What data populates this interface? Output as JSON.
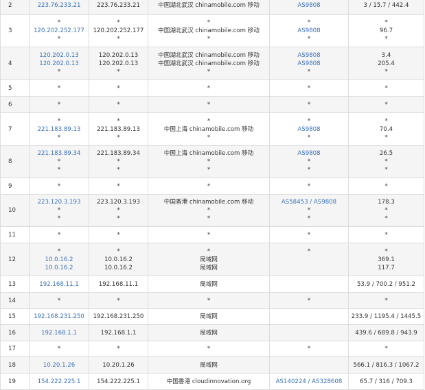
{
  "colors": {
    "link": "#3b72b8",
    "text": "#333333",
    "row_alt": "#f5f5f5",
    "border": "#dcdcdc"
  },
  "rows": [
    {
      "hop": "2",
      "ip": [
        "223.76.233.21"
      ],
      "host": [
        "223.76.233.21"
      ],
      "loc": [
        "中国湖北武汉 chinamobile.com 移动"
      ],
      "asn": [
        "AS9808"
      ],
      "time": [
        "3 / 15.7 / 442.4"
      ]
    },
    {
      "hop": "3",
      "ip": [
        "*",
        "120.202.252.177",
        "*"
      ],
      "host": [
        "*",
        "120.202.252.177",
        "*"
      ],
      "loc": [
        "*",
        "中国湖北武汉 chinamobile.com 移动",
        "*"
      ],
      "asn": [
        "*",
        "AS9808",
        "*"
      ],
      "time": [
        "*",
        "96.7",
        "*"
      ]
    },
    {
      "hop": "4",
      "ip": [
        "120.202.0.13",
        "120.202.0.13",
        "*"
      ],
      "host": [
        "120.202.0.13",
        "120.202.0.13",
        "*"
      ],
      "loc": [
        "中国湖北武汉 chinamobile.com 移动",
        "中国湖北武汉 chinamobile.com 移动",
        "*"
      ],
      "asn": [
        "AS9808",
        "AS9808",
        "*"
      ],
      "time": [
        "3.4",
        "205.4",
        "*"
      ]
    },
    {
      "hop": "5",
      "ip": [
        "*"
      ],
      "host": [
        "*"
      ],
      "loc": [
        "*"
      ],
      "asn": [
        "*"
      ],
      "time": [
        "*"
      ]
    },
    {
      "hop": "6",
      "ip": [
        "*"
      ],
      "host": [
        "*"
      ],
      "loc": [
        "*"
      ],
      "asn": [
        "*"
      ],
      "time": [
        "*"
      ]
    },
    {
      "hop": "7",
      "ip": [
        "*",
        "221.183.89.13",
        "*"
      ],
      "host": [
        "*",
        "221.183.89.13",
        "*"
      ],
      "loc": [
        "*",
        "中国上海 chinamobile.com 移动",
        "*"
      ],
      "asn": [
        "*",
        "AS9808",
        "*"
      ],
      "time": [
        "*",
        "70.4",
        "*"
      ]
    },
    {
      "hop": "8",
      "ip": [
        "221.183.89.34",
        "*",
        "*"
      ],
      "host": [
        "221.183.89.34",
        "*",
        "*"
      ],
      "loc": [
        "中国上海 chinamobile.com 移动",
        "*",
        "*"
      ],
      "asn": [
        "AS9808",
        "*",
        "*"
      ],
      "time": [
        "26.5",
        "*",
        "*"
      ]
    },
    {
      "hop": "9",
      "ip": [
        "*"
      ],
      "host": [
        "*"
      ],
      "loc": [
        "*"
      ],
      "asn": [
        "*"
      ],
      "time": [
        "*"
      ]
    },
    {
      "hop": "10",
      "ip": [
        "223.120.3.193",
        "*",
        "*"
      ],
      "host": [
        "223.120.3.193",
        "*",
        "*"
      ],
      "loc": [
        "中国香港 chinamobile.com 移动",
        "*",
        "*"
      ],
      "asn": [
        "AS58453 / AS9808",
        "*",
        "*"
      ],
      "time": [
        "178.3",
        "*",
        "*"
      ]
    },
    {
      "hop": "11",
      "ip": [
        "*"
      ],
      "host": [
        "*"
      ],
      "loc": [
        "*"
      ],
      "asn": [
        "*"
      ],
      "time": [
        "*"
      ]
    },
    {
      "hop": "12",
      "ip": [
        "*",
        "10.0.16.2",
        "10.0.16.2"
      ],
      "host": [
        "*",
        "10.0.16.2",
        "10.0.16.2"
      ],
      "loc": [
        "*",
        "局域网",
        "局域网"
      ],
      "asn": [
        "*",
        "",
        ""
      ],
      "time": [
        "*",
        "369.1",
        "117.7"
      ]
    },
    {
      "hop": "13",
      "ip": [
        "192.168.11.1"
      ],
      "host": [
        "192.168.11.1"
      ],
      "loc": [
        "局域网"
      ],
      "asn": [
        ""
      ],
      "time": [
        "53.9 / 700.2 / 951.2"
      ]
    },
    {
      "hop": "14",
      "ip": [
        "*"
      ],
      "host": [
        "*"
      ],
      "loc": [
        "*"
      ],
      "asn": [
        "*"
      ],
      "time": [
        "*"
      ]
    },
    {
      "hop": "15",
      "ip": [
        "192.168.231.250"
      ],
      "host": [
        "192.168.231.250"
      ],
      "loc": [
        "局域网"
      ],
      "asn": [
        ""
      ],
      "time": [
        "233.9 / 1195.4 / 1445.5"
      ]
    },
    {
      "hop": "16",
      "ip": [
        "192.168.1.1"
      ],
      "host": [
        "192.168.1.1"
      ],
      "loc": [
        "局域网"
      ],
      "asn": [
        ""
      ],
      "time": [
        "439.6 / 689.8 / 943.9"
      ]
    },
    {
      "hop": "17",
      "ip": [
        "*"
      ],
      "host": [
        "*"
      ],
      "loc": [
        "*"
      ],
      "asn": [
        "*"
      ],
      "time": [
        "*"
      ]
    },
    {
      "hop": "18",
      "ip": [
        "10.20.1.26"
      ],
      "host": [
        "10.20.1.26"
      ],
      "loc": [
        "局域网"
      ],
      "asn": [
        ""
      ],
      "time": [
        "566.1 / 816.3 / 1067.2"
      ]
    },
    {
      "hop": "19",
      "ip": [
        "154.222.225.1"
      ],
      "host": [
        "154.222.225.1"
      ],
      "loc": [
        "中国香港 cloudinnovation.org"
      ],
      "asn": [
        "AS140224 / AS328608"
      ],
      "time": [
        "65.7 / 316 / 709.3"
      ]
    }
  ]
}
